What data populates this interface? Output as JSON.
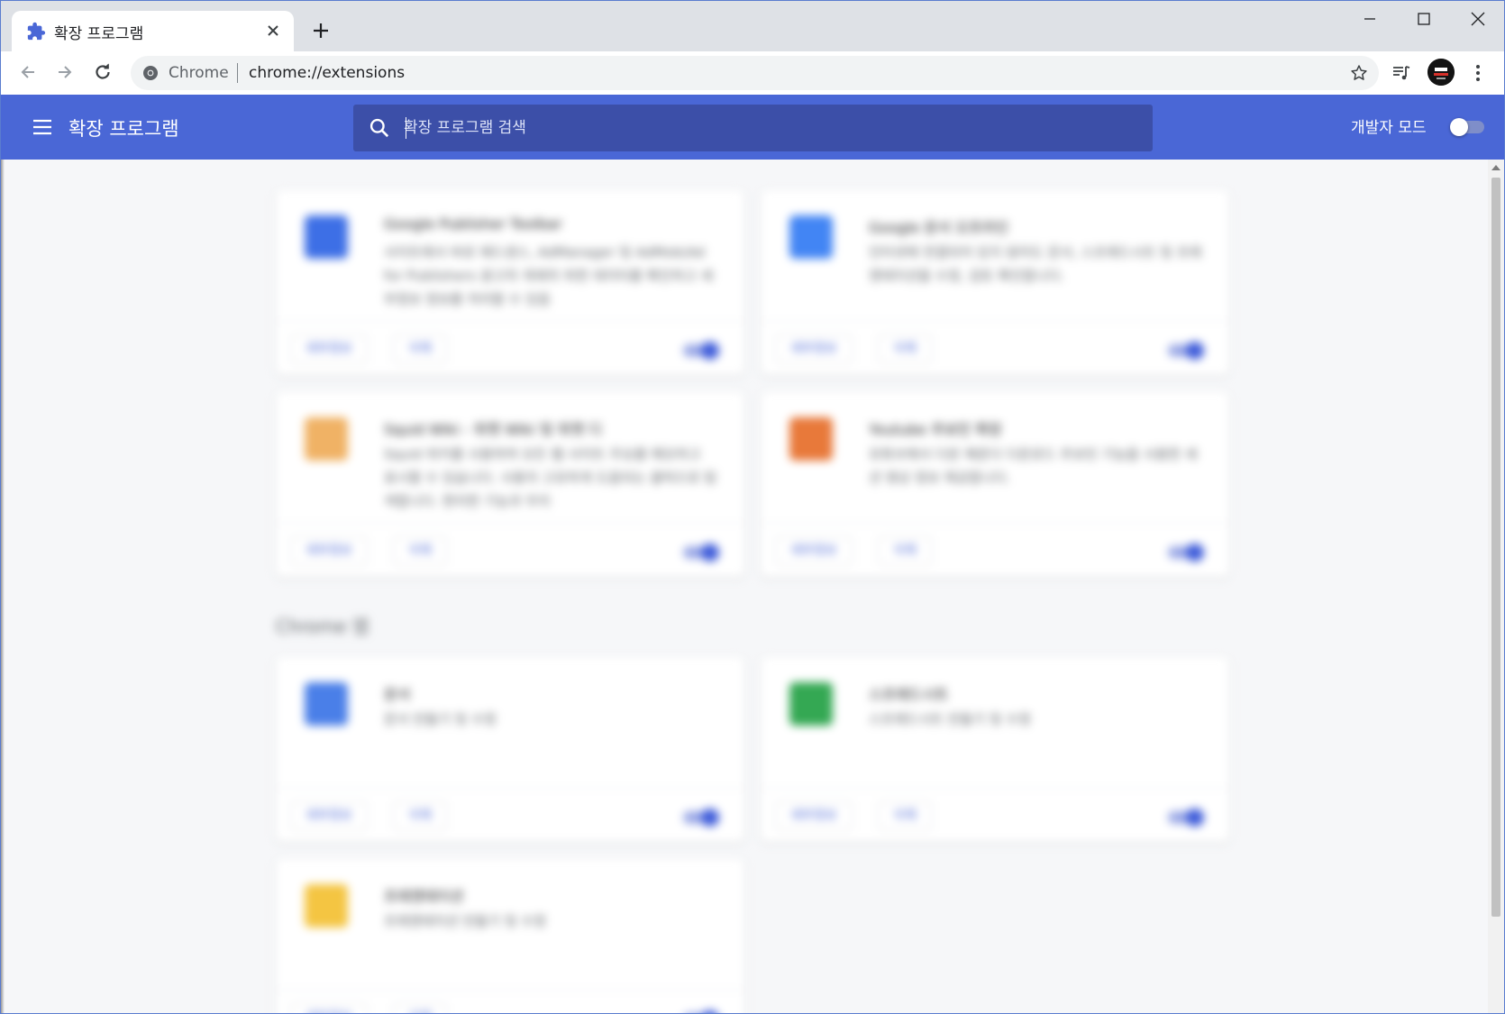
{
  "browser": {
    "tab_title": "확장 프로그램",
    "omnibox_chip": "Chrome",
    "omnibox_url": "chrome://extensions"
  },
  "extensions_page": {
    "title": "확장 프로그램",
    "search_placeholder": "확장 프로그램 검색",
    "dev_mode_label": "개발자 모드",
    "dev_mode_on": false,
    "section_chrome_apps": "Chrome 앱",
    "details_label": "세부정보",
    "remove_label": "삭제",
    "extensions": [
      {
        "name": "Google Publisher Toolbar",
        "desc": "사이트에서 바로 애드센스, AdManager 및 AdMob(Ad for Publishers 광고의 게재의 위한 데이터를 확인하고 세부정보 정보를 처리할 수 있음",
        "enabled": true,
        "icon_color": "#3d6fe6"
      },
      {
        "name": "Google 문서 오프라인",
        "desc": "인터넷에 연결되어 있지 않아도 문서, 스프레드시트 및 프레젠테이션을 수정, 검토 확인합니다.",
        "enabled": true,
        "icon_color": "#4285f4"
      },
      {
        "name": "Squid Wiki - 위젯 Wiki 및 위젯 디",
        "desc": "Squid 위키를 사용하여 모든 웹 사이트 주요를 메모하고 표시할 수 있습니다. 사용자 고유하게 도움되는 클릭으로 탐색합니다. 편리한 기능과 우리",
        "enabled": true,
        "icon_color": "#f0b265"
      },
      {
        "name": "Youtube 추보민 확장",
        "desc": "유튜브에서 다운 해준다 다운로드 추보민 기능을 사용한 세션 영상 정보 제공합니다.",
        "enabled": true,
        "icon_color": "#e8793a"
      },
      {
        "name": "문서",
        "desc": "문서 만들기 및 수정",
        "enabled": true,
        "icon_color": "#4a7fe8"
      },
      {
        "name": "스프레드시트",
        "desc": "스프레드시트 만들기 및 수정",
        "enabled": true,
        "icon_color": "#34a853"
      },
      {
        "name": "프레젠테이션",
        "desc": "프레젠테이션 만들기 및 수정",
        "enabled": true,
        "icon_color": "#f4c542"
      }
    ]
  },
  "colors": {
    "header_blue": "#4a67d6",
    "search_bg": "#3c4fa8",
    "accent": "#3d5bd9"
  }
}
